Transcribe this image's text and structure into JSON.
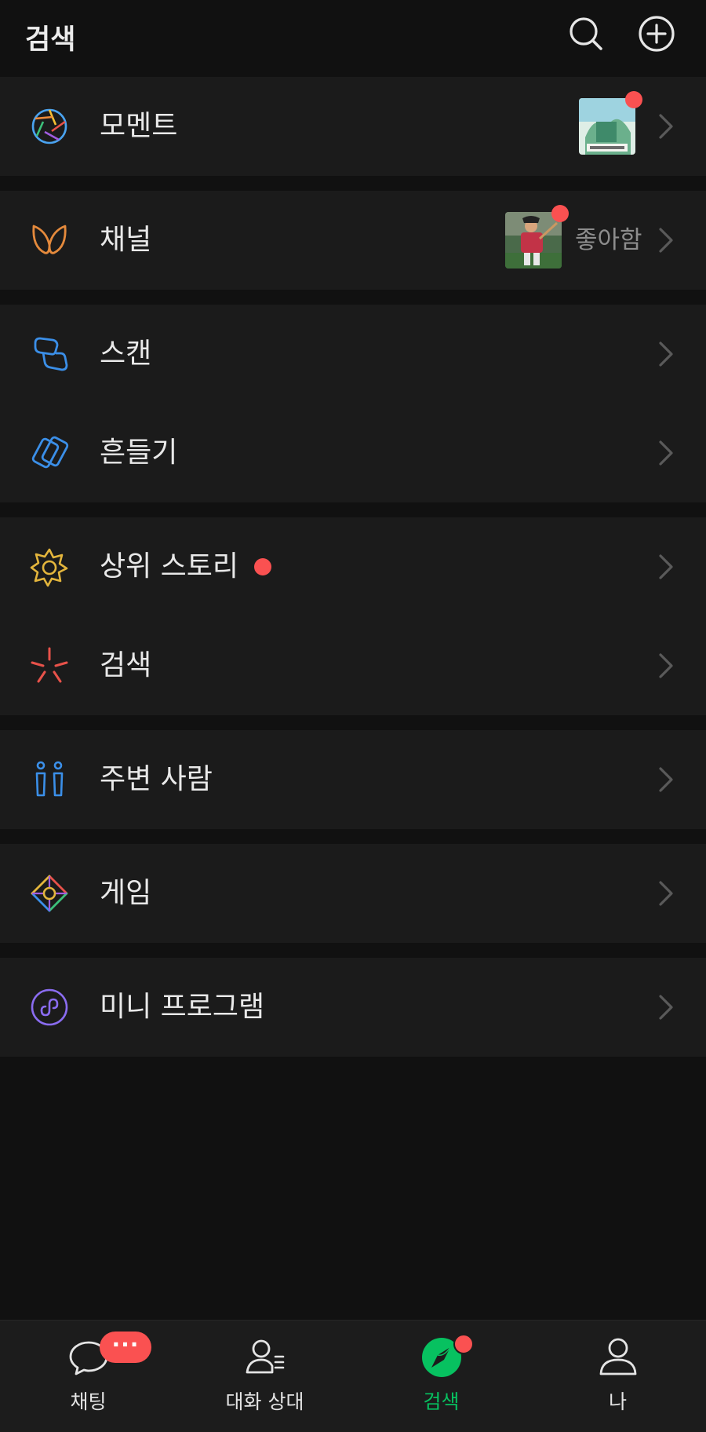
{
  "header": {
    "title": "검색",
    "search_icon": "search-icon",
    "add_icon": "plus-circle-icon"
  },
  "menu": {
    "moments": {
      "label": "모멘트",
      "icon": "moments-aperture-icon",
      "has_new_dot": true
    },
    "channels": {
      "label": "채널",
      "icon": "channels-butterfly-icon",
      "side_text": "좋아함",
      "has_new_dot": true
    },
    "scan": {
      "label": "스캔",
      "icon": "scan-icon"
    },
    "shake": {
      "label": "흔들기",
      "icon": "shake-icon"
    },
    "top_stories": {
      "label": "상위 스토리",
      "icon": "top-stories-icon",
      "has_new_dot": true
    },
    "search": {
      "label": "검색",
      "icon": "search-sparkle-icon"
    },
    "people_nearby": {
      "label": "주변 사람",
      "icon": "people-nearby-icon"
    },
    "games": {
      "label": "게임",
      "icon": "games-diamond-icon"
    },
    "mini_programs": {
      "label": "미니 프로그램",
      "icon": "mini-programs-icon"
    }
  },
  "tabbar": {
    "chats": {
      "label": "채팅",
      "icon": "chat-bubble-icon",
      "badge": "···"
    },
    "contacts": {
      "label": "대화 상대",
      "icon": "contacts-icon"
    },
    "discover": {
      "label": "검색",
      "icon": "discover-compass-icon",
      "active": true,
      "has_new_dot": true
    },
    "me": {
      "label": "나",
      "icon": "person-icon"
    }
  },
  "colors": {
    "background": "#111111",
    "cell": "#1b1b1b",
    "accent_green": "#07c160",
    "badge_red": "#fa5151",
    "secondary_text": "#8d8d8d"
  }
}
